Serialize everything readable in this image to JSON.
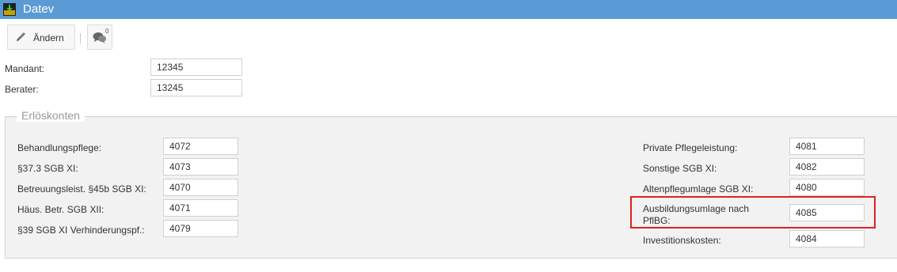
{
  "window": {
    "title": "Datev"
  },
  "toolbar": {
    "edit_label": "Ändern",
    "comment_count": "0"
  },
  "header_fields": {
    "mandant": {
      "label": "Mandant:",
      "value": "12345"
    },
    "berater": {
      "label": "Berater:",
      "value": "13245"
    }
  },
  "erloeskonten": {
    "legend": "Erlöskonten",
    "left": [
      {
        "label": "Behandlungspflege:",
        "value": "4072"
      },
      {
        "label": "§37.3 SGB XI:",
        "value": "4073"
      },
      {
        "label": "Betreuungsleist. §45b SGB XI:",
        "value": "4070"
      },
      {
        "label": "Häus. Betr. SGB XII:",
        "value": "4071"
      },
      {
        "label": "§39 SGB XI Verhinderungspf.:",
        "value": "4079"
      }
    ],
    "right": [
      {
        "label": "Private Pflegeleistung:",
        "value": "4081"
      },
      {
        "label": "Sonstige SGB XI:",
        "value": "4082"
      },
      {
        "label": "Altenpflegumlage SGB XI:",
        "value": "4080"
      },
      {
        "label_line1": "Ausbildungsumlage nach",
        "label_line2": "PflBG:",
        "value": "4085"
      },
      {
        "label": "Investitionskosten:",
        "value": "4084"
      }
    ]
  },
  "colors": {
    "titlebar": "#5b9bd5",
    "highlight": "#e02020"
  }
}
